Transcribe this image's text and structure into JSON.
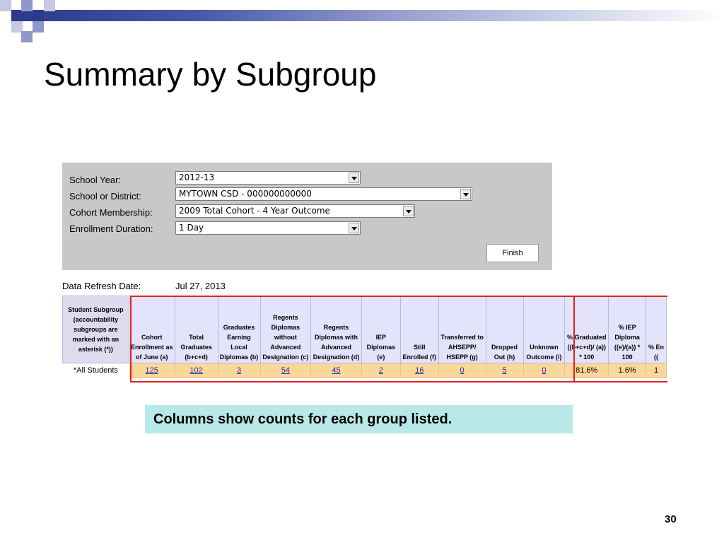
{
  "slide": {
    "title": "Summary by Subgroup",
    "page_number": "30",
    "caption": "Columns show counts for each group listed."
  },
  "form": {
    "school_year_label": "School Year:",
    "school_year_value": "2012-13",
    "school_label": "School or District:",
    "school_value": "MYTOWN CSD - 000000000000",
    "cohort_label": "Cohort Membership:",
    "cohort_value": "2009 Total Cohort - 4 Year Outcome",
    "duration_label": "Enrollment Duration:",
    "duration_value": "1 Day",
    "finish_label": "Finish"
  },
  "refresh": {
    "label": "Data Refresh Date:",
    "value": "Jul 27, 2013"
  },
  "table": {
    "headers": [
      "Student Subgroup (accountability subgroups are marked with an asterisk (*))",
      "Cohort Enrollment as of June (a)",
      "Total Graduates (b+c+d)",
      "Graduates Earning Local Diplomas (b)",
      "Regents Diplomas without Advanced Designation (c)",
      "Regents Diplomas with Advanced Designation (d)",
      "IEP Diplomas (e)",
      "Still Enrolled (f)",
      "Transferred to AHSEPP/ HSEPP (g)",
      "Dropped Out (h)",
      "Unknown Outcome (i)",
      "% Graduated ((b+c+d)/ (a)) * 100",
      "% IEP Diploma ((e)/(a)) * 100",
      "% En (("
    ],
    "row": {
      "subgroup": "*All Students",
      "cells": [
        "125",
        "102",
        "3",
        "54",
        "45",
        "2",
        "16",
        "0",
        "5",
        "0",
        "81.6%",
        "1.6%",
        "1"
      ]
    }
  }
}
